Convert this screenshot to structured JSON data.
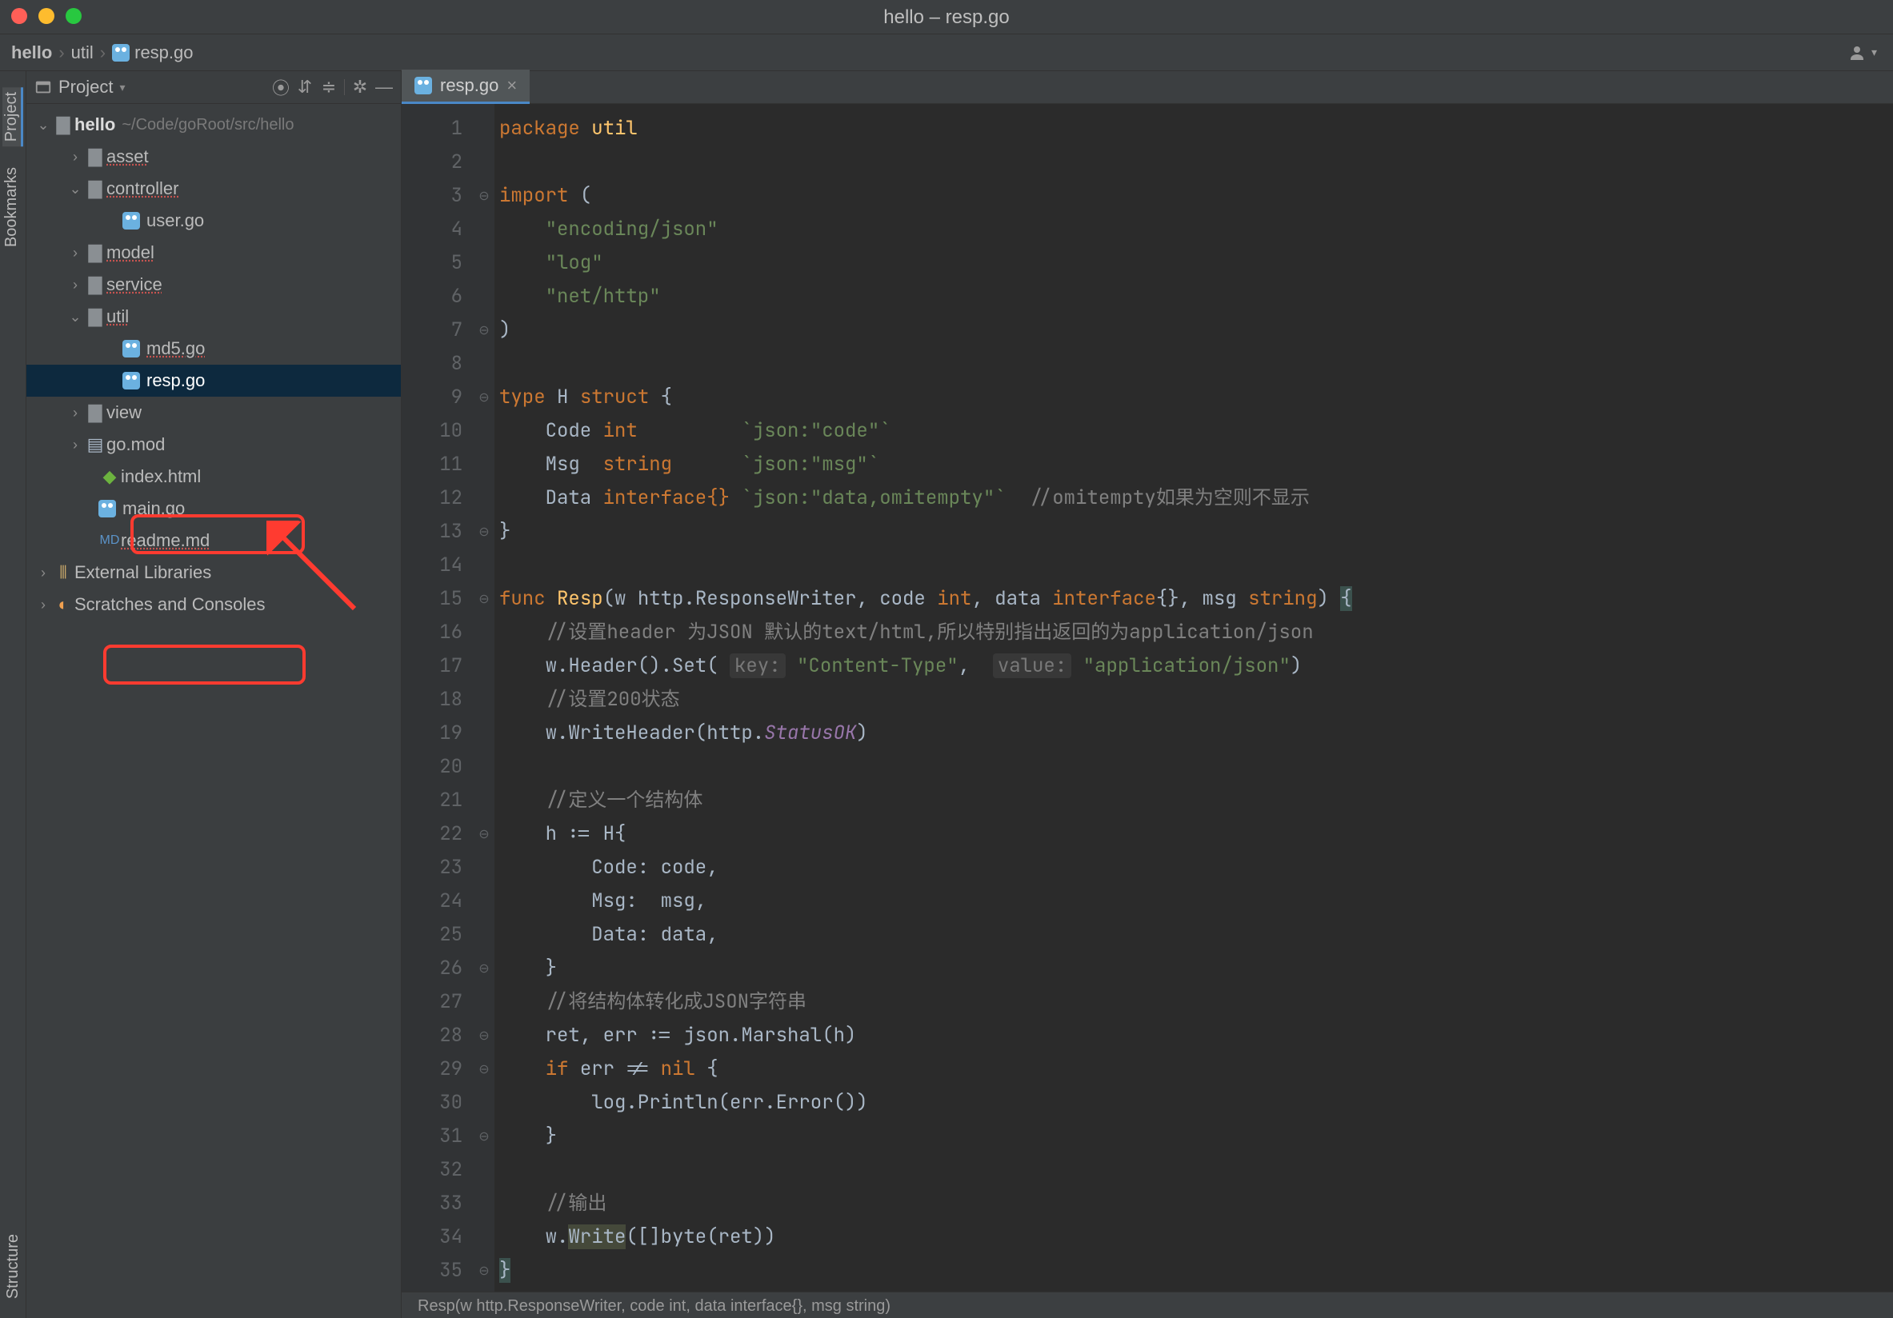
{
  "window": {
    "title": "hello – resp.go"
  },
  "breadcrumbs": [
    "hello",
    "util",
    "resp.go"
  ],
  "sidebar": {
    "view_label": "Project",
    "strip_labels": {
      "project": "Project",
      "bookmarks": "Bookmarks",
      "structure": "Structure"
    },
    "tree": {
      "root_name": "hello",
      "root_path": "~/Code/goRoot/src/hello",
      "children": [
        {
          "name": "asset",
          "type": "dir",
          "expanded": false,
          "children": []
        },
        {
          "name": "controller",
          "type": "dir",
          "expanded": true,
          "children": [
            {
              "name": "user.go",
              "type": "go"
            }
          ]
        },
        {
          "name": "model",
          "type": "dir",
          "expanded": false,
          "children": []
        },
        {
          "name": "service",
          "type": "dir",
          "expanded": false,
          "children": []
        },
        {
          "name": "util",
          "type": "dir",
          "expanded": true,
          "children": [
            {
              "name": "md5.go",
              "type": "go"
            },
            {
              "name": "resp.go",
              "type": "go",
              "selected": true
            }
          ]
        },
        {
          "name": "view",
          "type": "dir",
          "expanded": false,
          "children": []
        },
        {
          "name": "go.mod",
          "type": "file"
        },
        {
          "name": "index.html",
          "type": "file"
        },
        {
          "name": "main.go",
          "type": "go"
        },
        {
          "name": "readme.md",
          "type": "md"
        }
      ],
      "extra": [
        {
          "name": "External Libraries",
          "type": "lib"
        },
        {
          "name": "Scratches and Consoles",
          "type": "scratch"
        }
      ]
    }
  },
  "tabs": [
    {
      "label": "resp.go",
      "active": true
    }
  ],
  "editor": {
    "filename": "resp.go",
    "package": "util",
    "line_count": 35,
    "imports": [
      "encoding/json",
      "log",
      "net/http"
    ],
    "struct": {
      "name": "H",
      "fields": [
        {
          "name": "Code",
          "type": "int",
          "tag": "`json:\"code\"`"
        },
        {
          "name": "Msg",
          "type": "string",
          "tag": "`json:\"msg\"`"
        },
        {
          "name": "Data",
          "type": "interface{}",
          "tag": "`json:\"data,omitempty\"`",
          "comment": "//omitempty如果为空则不显示"
        }
      ]
    },
    "func": {
      "name": "Resp",
      "params": "w http.ResponseWriter, code int, data interface{}, msg string",
      "hints": {
        "key": "key:",
        "value": "value:",
        "key_val": "\"Content-Type\"",
        "value_val": "\"application/json\""
      },
      "comments": {
        "c1": "//设置header 为JSON 默认的text/html,所以特别指出返回的为application/json",
        "c2": "//设置200状态",
        "c3": "//定义一个结构体",
        "c4": "//将结构体转化成JSON字符串",
        "c5": "//输出"
      }
    }
  },
  "status": "Resp(w http.ResponseWriter, code int, data interface{}, msg string)"
}
